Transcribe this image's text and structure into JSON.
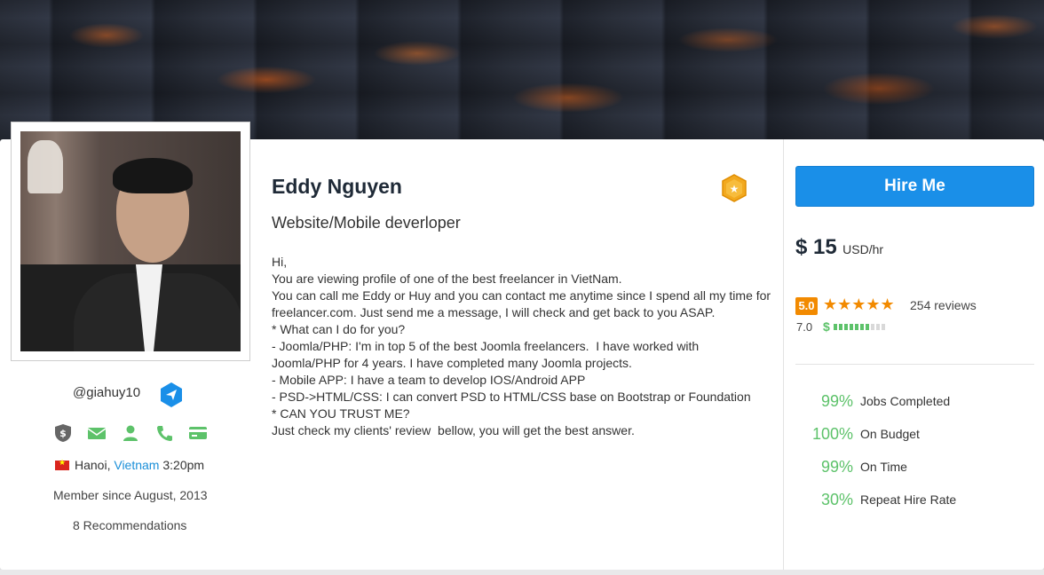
{
  "profile": {
    "username": "@giahuy10",
    "name": "Eddy Nguyen",
    "tagline": "Website/Mobile deverloper",
    "location": {
      "city": "Hanoi, ",
      "country": "Vietnam",
      "time": " 3:20pm"
    },
    "member_since": "Member since August, 2013",
    "recommendations": "8 Recommendations",
    "bio": [
      "Hi,",
      "You are viewing profile of one of the best freelancer in VietNam.",
      "You can call me Eddy or Huy and you can contact me anytime since I spend all my time for",
      "freelancer.com. Just send me a message, I will check and get back to you ASAP.",
      "* What can I do for you?",
      "- Joomla/PHP: I'm in top 5 of the best Joomla freelancers.  I have worked with",
      "Joomla/PHP for 4 years. I have completed many Joomla projects.",
      "- Mobile APP: I have a team to develop IOS/Android APP",
      "- PSD->HTML/CSS: I can convert PSD to HTML/CSS base on Bootstrap or Foundation",
      "* CAN YOU TRUST ME?",
      "Just check my clients' review  bellow, you will get the best answer."
    ]
  },
  "verifications": [
    "shield-dollar-icon",
    "email-icon",
    "user-icon",
    "phone-icon",
    "credit-card-icon"
  ],
  "sidebar": {
    "hire_label": "Hire Me",
    "rate_amount": "$ 15",
    "rate_unit": "USD/hr",
    "rating_score": "5.0",
    "stars": "★★★★★",
    "stars_value": 5,
    "reviews": "254 reviews",
    "earnings_score": "7.0",
    "earnings_level": 0.7,
    "stats": [
      {
        "value": "99%",
        "label": "Jobs Completed"
      },
      {
        "value": "100%",
        "label": "On Budget"
      },
      {
        "value": "99%",
        "label": "On Time"
      },
      {
        "value": "30%",
        "label": "Repeat Hire Rate"
      }
    ]
  },
  "colors": {
    "accent": "#1a8fe8",
    "rating": "#f28a00",
    "success": "#5dc26a",
    "link": "#1a8fd8"
  }
}
